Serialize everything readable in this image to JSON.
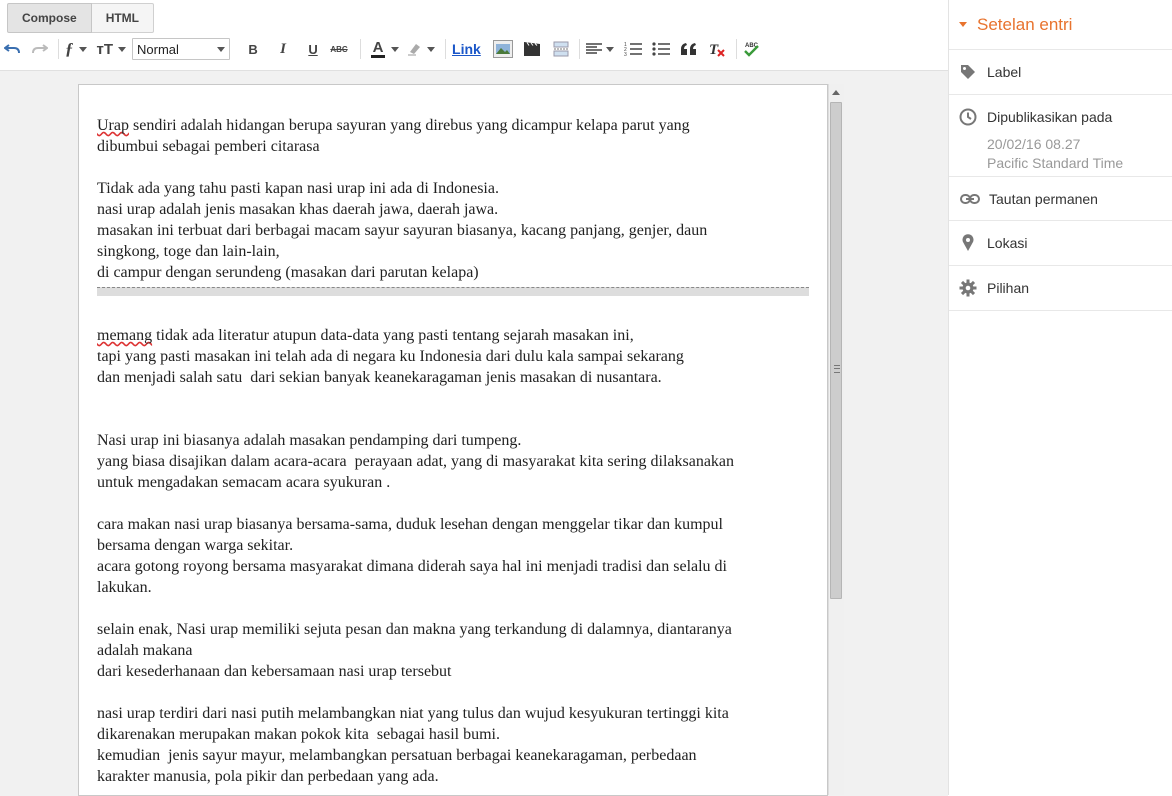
{
  "modes": {
    "compose": "Compose",
    "html": "HTML"
  },
  "toolbar": {
    "font_size_select": "Normal",
    "link_label": "Link",
    "icons": [
      "undo-icon",
      "redo-icon",
      "font-family-icon",
      "font-size-icon",
      "bold-icon",
      "italic-icon",
      "underline-icon",
      "strikethrough-icon",
      "text-color-icon",
      "highlight-icon",
      "link",
      "image-icon",
      "video-icon",
      "jump-break-icon",
      "align-icon",
      "numbered-list-icon",
      "bullet-list-icon",
      "quote-icon",
      "clear-format-icon",
      "spellcheck-icon"
    ],
    "bold": "B",
    "italic": "I",
    "underline": "U",
    "strike": "ABC",
    "text_color": "A",
    "spell": "ABC"
  },
  "content": {
    "p1a_misspelled": "Urap",
    "p1a_rest": " sendiri adalah hidangan berupa sayuran yang direbus yang dicampur kelapa parut yang",
    "p1b": "dibumbui sebagai pemberi citarasa",
    "p2": "Tidak ada yang tahu pasti kapan nasi urap ini ada di Indonesia.",
    "p3": "nasi urap adalah jenis masakan khas daerah jawa, daerah jawa.",
    "p4a": "masakan ini terbuat dari berbagai macam sayur sayuran biasanya, kacang panjang, genjer, daun",
    "p4b": "singkong, toge dan lain-lain,",
    "p5": "di campur dengan serundeng (masakan dari parutan kelapa)",
    "p6_misspelled": "memang",
    "p6_rest": " tidak ada literatur atupun data-data yang pasti tentang sejarah masakan ini,",
    "p7": "tapi yang pasti masakan ini telah ada di negara ku Indonesia dari dulu kala sampai sekarang",
    "p8": "dan menjadi salah satu  dari sekian banyak keanekaragaman jenis masakan di nusantara.",
    "p9": "Nasi urap ini biasanya adalah masakan pendamping dari tumpeng.",
    "p10a": "yang biasa disajikan dalam acara-acara  perayaan adat, yang di masyarakat kita sering dilaksanakan",
    "p10b": "untuk mengadakan semacam acara syukuran .",
    "p11a": "cara makan nasi urap biasanya bersama-sama, duduk lesehan dengan menggelar tikar dan kumpul",
    "p11b": "bersama dengan warga sekitar.",
    "p12a": "acara gotong royong bersama masyarakat dimana diderah saya hal ini menjadi tradisi dan selalu di",
    "p12b": "lakukan.",
    "p13a": "selain enak, Nasi urap memiliki sejuta pesan dan makna yang terkandung di dalamnya, diantaranya",
    "p13b": "adalah makana",
    "p14": "dari kesederhanaan dan kebersamaan nasi urap tersebut",
    "p15a": "nasi urap terdiri dari nasi putih melambangkan niat yang tulus dan wujud kesyukuran tertinggi kita",
    "p15b": "dikarenakan merupakan makan pokok kita  sebagai hasil bumi.",
    "p16a": "kemudian  jenis sayur mayur, melambangkan persatuan berbagai keanekaragaman, perbedaan",
    "p16b": "karakter manusia, pola pikir dan perbedaan yang ada."
  },
  "sidebar": {
    "title": "Setelan entri",
    "label": "Label",
    "published": "Dipublikasikan pada",
    "published_date": "20/02/16 08.27",
    "timezone": "Pacific Standard Time",
    "permalink": "Tautan permanen",
    "location": "Lokasi",
    "options": "Pilihan"
  },
  "colors": {
    "accent": "#e8732e",
    "link": "#1a56c8"
  }
}
